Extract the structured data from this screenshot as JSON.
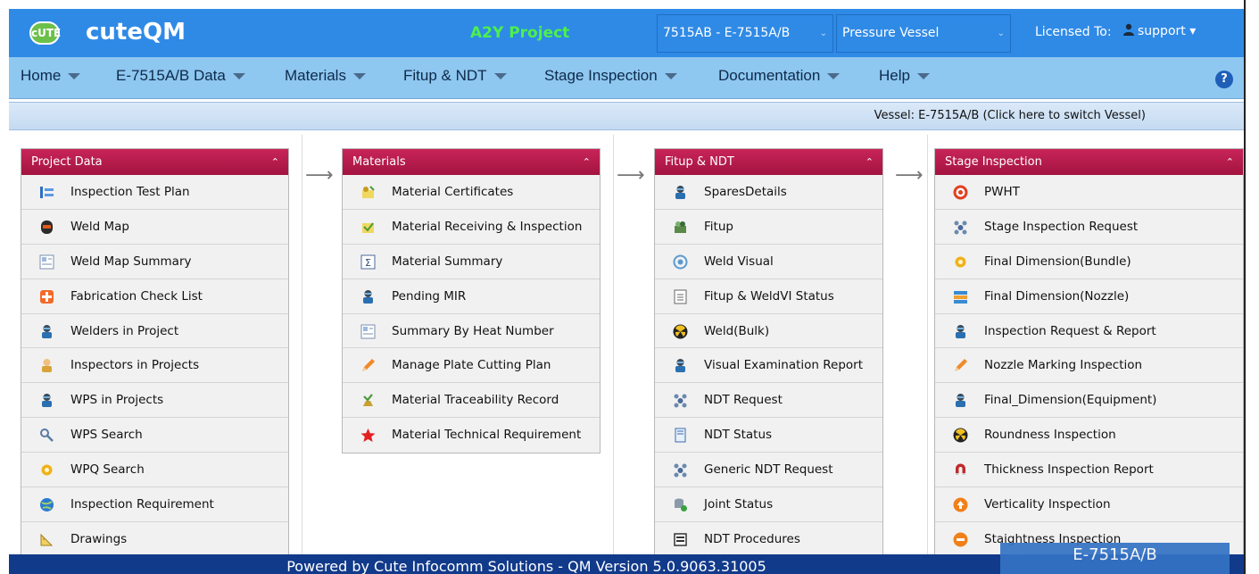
{
  "header": {
    "logo_text": "cUTE",
    "app_name": "cuteQM",
    "project": "A2Y Project",
    "vessel_select": "7515AB - E-7515A/B",
    "type_select": "Pressure Vessel",
    "licensed_label": "Licensed To:",
    "user": "support ▾",
    "accent_color": "#2f8ae6",
    "project_color": "#4cf04c"
  },
  "menu": {
    "items": [
      "Home",
      "E-7515A/B Data",
      "Materials",
      "Fitup & NDT",
      "Stage Inspection",
      "Documentation",
      "Help"
    ],
    "help_icon": "?"
  },
  "vessel_banner": "Vessel: E-7515A/B (Click here to switch Vessel)",
  "panels": [
    {
      "title": "Project Data",
      "items": [
        {
          "label": "Inspection Test Plan",
          "icon": "list-icon"
        },
        {
          "label": "Weld Map",
          "icon": "welder-mask-icon"
        },
        {
          "label": "Weld Map Summary",
          "icon": "summary-icon"
        },
        {
          "label": "Fabrication Check List",
          "icon": "plus-box-icon"
        },
        {
          "label": "Welders in Project",
          "icon": "welder-icon"
        },
        {
          "label": "Inspectors in Projects",
          "icon": "inspector-icon"
        },
        {
          "label": "WPS in Projects",
          "icon": "welder-icon"
        },
        {
          "label": "WPS Search",
          "icon": "search-icon"
        },
        {
          "label": "WPQ Search",
          "icon": "gear-icon"
        },
        {
          "label": "Inspection Requirement",
          "icon": "globe-icon"
        },
        {
          "label": "Drawings",
          "icon": "ruler-icon"
        }
      ]
    },
    {
      "title": "Materials",
      "items": [
        {
          "label": "Material Certificates",
          "icon": "certificate-icon"
        },
        {
          "label": "Material Receiving & Inspection",
          "icon": "receiving-icon"
        },
        {
          "label": "Material Summary",
          "icon": "sigma-icon"
        },
        {
          "label": "Pending MIR",
          "icon": "welder-icon"
        },
        {
          "label": "Summary By Heat Number",
          "icon": "summary-icon"
        },
        {
          "label": "Manage Plate Cutting Plan",
          "icon": "pencil-icon"
        },
        {
          "label": "Material Traceability Record",
          "icon": "trace-icon"
        },
        {
          "label": "Material Technical Requirement",
          "icon": "star-icon"
        }
      ]
    },
    {
      "title": "Fitup & NDT",
      "items": [
        {
          "label": "SparesDetails",
          "icon": "welder-icon"
        },
        {
          "label": "Fitup",
          "icon": "fitup-icon"
        },
        {
          "label": "Weld Visual",
          "icon": "visual-icon"
        },
        {
          "label": "Fitup & WeldVI Status",
          "icon": "doc-icon"
        },
        {
          "label": "Weld(Bulk)",
          "icon": "radiation-icon"
        },
        {
          "label": "Visual Examination Report",
          "icon": "welder-icon"
        },
        {
          "label": "NDT Request",
          "icon": "molecule-icon"
        },
        {
          "label": "NDT Status",
          "icon": "page-icon"
        },
        {
          "label": "Generic NDT Request",
          "icon": "molecule-icon"
        },
        {
          "label": "Joint Status",
          "icon": "database-icon"
        },
        {
          "label": "NDT Procedures",
          "icon": "procedure-icon"
        }
      ]
    },
    {
      "title": "Stage Inspection",
      "items": [
        {
          "label": "PWHT",
          "icon": "target-icon"
        },
        {
          "label": "Stage Inspection Request",
          "icon": "molecule-icon"
        },
        {
          "label": "Final Dimension(Bundle)",
          "icon": "gear-icon"
        },
        {
          "label": "Final Dimension(Nozzle)",
          "icon": "nozzle-icon"
        },
        {
          "label": "Inspection Request & Report",
          "icon": "welder-icon"
        },
        {
          "label": "Nozzle Marking Inspection",
          "icon": "pencil-icon"
        },
        {
          "label": "Final_Dimension(Equipment)",
          "icon": "welder-icon"
        },
        {
          "label": "Roundness Inspection",
          "icon": "radiation-icon"
        },
        {
          "label": "Thickness Inspection Report",
          "icon": "magnet-icon"
        },
        {
          "label": "Verticality Inspection",
          "icon": "up-arrow-icon"
        },
        {
          "label": "Staightness Inspection",
          "icon": "minus-circle-icon"
        }
      ]
    }
  ],
  "footer": "Powered by Cute Infocomm Solutions - QM Version 5.0.9063.31005",
  "vessel_tag": "E-7515A/B"
}
